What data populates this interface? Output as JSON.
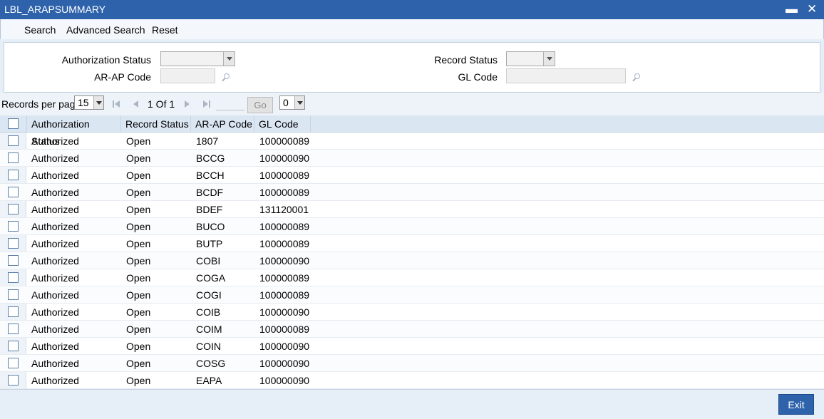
{
  "window": {
    "title": "LBL_ARAPSUMMARY",
    "minimize_symbol": "▬",
    "close_symbol": "✕"
  },
  "toolbar": {
    "search_label": "Search",
    "advanced_search_label": "Advanced Search",
    "reset_label": "Reset"
  },
  "filters": {
    "authorization_status_label": "Authorization Status",
    "authorization_status_value": "",
    "record_status_label": "Record Status",
    "record_status_value": "",
    "arap_code_label": "AR-AP Code",
    "arap_code_value": "",
    "gl_code_label": "GL Code",
    "gl_code_value": ""
  },
  "pager": {
    "records_per_page_label": "Records per page",
    "records_per_page_value": "15",
    "page_info": "1 Of 1",
    "goto_value": "",
    "go_label": "Go",
    "extra_select_value": "0"
  },
  "grid": {
    "columns": [
      "Authorization Status",
      "Record Status",
      "AR-AP Code",
      "GL Code"
    ],
    "rows": [
      [
        "Authorized",
        "Open",
        "1807",
        "100000089"
      ],
      [
        "Authorized",
        "Open",
        "BCCG",
        "100000090"
      ],
      [
        "Authorized",
        "Open",
        "BCCH",
        "100000089"
      ],
      [
        "Authorized",
        "Open",
        "BCDF",
        "100000089"
      ],
      [
        "Authorized",
        "Open",
        "BDEF",
        "131120001"
      ],
      [
        "Authorized",
        "Open",
        "BUCO",
        "100000089"
      ],
      [
        "Authorized",
        "Open",
        "BUTP",
        "100000089"
      ],
      [
        "Authorized",
        "Open",
        "COBI",
        "100000090"
      ],
      [
        "Authorized",
        "Open",
        "COGA",
        "100000089"
      ],
      [
        "Authorized",
        "Open",
        "COGI",
        "100000089"
      ],
      [
        "Authorized",
        "Open",
        "COIB",
        "100000090"
      ],
      [
        "Authorized",
        "Open",
        "COIM",
        "100000089"
      ],
      [
        "Authorized",
        "Open",
        "COIN",
        "100000090"
      ],
      [
        "Authorized",
        "Open",
        "COSG",
        "100000090"
      ],
      [
        "Authorized",
        "Open",
        "EAPA",
        "100000090"
      ]
    ]
  },
  "footer": {
    "exit_label": "Exit"
  },
  "colors": {
    "titlebar": "#2e63ab",
    "background": "#e6eef8",
    "header": "#dbe6f3"
  }
}
